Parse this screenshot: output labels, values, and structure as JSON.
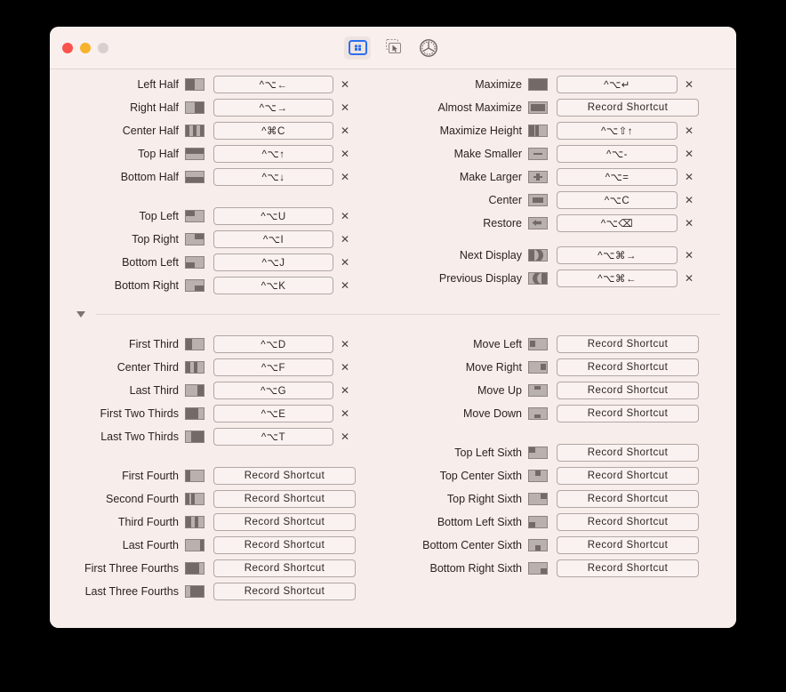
{
  "window": {
    "title": "",
    "traffic_lights": [
      "close",
      "minimize",
      "zoom"
    ],
    "accent": "#2a6ff0",
    "bg": "#f7eeec"
  },
  "toolbar": {
    "items": [
      {
        "name": "snap-areas-tab",
        "icon": "window-snap-icon",
        "active": true
      },
      {
        "name": "drag-snap-tab",
        "icon": "drag-to-snap-icon",
        "active": false
      },
      {
        "name": "settings-tab",
        "icon": "gear-icon",
        "active": false
      }
    ]
  },
  "record_placeholder": "Record Shortcut",
  "clear_glyph": "✕",
  "sections": {
    "left_top": [
      {
        "label": "Left Half",
        "thumb": "left-half",
        "shortcut": "^⌥←"
      },
      {
        "label": "Right Half",
        "thumb": "right-half",
        "shortcut": "^⌥→"
      },
      {
        "label": "Center Half",
        "thumb": "center-half",
        "shortcut": "^⌘C"
      },
      {
        "label": "Top Half",
        "thumb": "top-half",
        "shortcut": "^⌥↑"
      },
      {
        "label": "Bottom Half",
        "thumb": "bottom-half",
        "shortcut": "^⌥↓"
      }
    ],
    "left_quarters": [
      {
        "label": "Top Left",
        "thumb": "top-left",
        "shortcut": "^⌥U"
      },
      {
        "label": "Top Right",
        "thumb": "top-right",
        "shortcut": "^⌥I"
      },
      {
        "label": "Bottom Left",
        "thumb": "bottom-left",
        "shortcut": "^⌥J"
      },
      {
        "label": "Bottom Right",
        "thumb": "bottom-right",
        "shortcut": "^⌥K"
      }
    ],
    "left_thirds": [
      {
        "label": "First Third",
        "thumb": "first-third",
        "shortcut": "^⌥D"
      },
      {
        "label": "Center Third",
        "thumb": "center-third",
        "shortcut": "^⌥F"
      },
      {
        "label": "Last Third",
        "thumb": "last-third",
        "shortcut": "^⌥G"
      },
      {
        "label": "First Two Thirds",
        "thumb": "first-two-thirds",
        "shortcut": "^⌥E"
      },
      {
        "label": "Last Two Thirds",
        "thumb": "last-two-thirds",
        "shortcut": "^⌥T"
      }
    ],
    "left_fourths": [
      {
        "label": "First Fourth",
        "thumb": "first-fourth",
        "shortcut": ""
      },
      {
        "label": "Second Fourth",
        "thumb": "second-fourth",
        "shortcut": ""
      },
      {
        "label": "Third Fourth",
        "thumb": "third-fourth",
        "shortcut": ""
      },
      {
        "label": "Last Fourth",
        "thumb": "last-fourth",
        "shortcut": ""
      },
      {
        "label": "First Three Fourths",
        "thumb": "first-three-fourths",
        "shortcut": ""
      },
      {
        "label": "Last Three Fourths",
        "thumb": "last-three-fourths",
        "shortcut": ""
      }
    ],
    "right_top": [
      {
        "label": "Maximize",
        "thumb": "maximize",
        "shortcut": "^⌥↵"
      },
      {
        "label": "Almost Maximize",
        "thumb": "almost-maximize",
        "shortcut": ""
      },
      {
        "label": "Maximize Height",
        "thumb": "maximize-height",
        "shortcut": "^⌥⇧↑"
      },
      {
        "label": "Make Smaller",
        "thumb": "make-smaller",
        "shortcut": "^⌥-"
      },
      {
        "label": "Make Larger",
        "thumb": "make-larger",
        "shortcut": "^⌥="
      },
      {
        "label": "Center",
        "thumb": "center",
        "shortcut": "^⌥C"
      },
      {
        "label": "Restore",
        "thumb": "restore",
        "shortcut": "^⌥⌫"
      }
    ],
    "right_displays": [
      {
        "label": "Next Display",
        "thumb": "next-display",
        "shortcut": "^⌥⌘→"
      },
      {
        "label": "Previous Display",
        "thumb": "previous-display",
        "shortcut": "^⌥⌘←"
      }
    ],
    "right_moves": [
      {
        "label": "Move Left",
        "thumb": "move-left",
        "shortcut": ""
      },
      {
        "label": "Move Right",
        "thumb": "move-right",
        "shortcut": ""
      },
      {
        "label": "Move Up",
        "thumb": "move-up",
        "shortcut": ""
      },
      {
        "label": "Move Down",
        "thumb": "move-down",
        "shortcut": ""
      }
    ],
    "right_sixths": [
      {
        "label": "Top Left Sixth",
        "thumb": "top-left-sixth",
        "shortcut": ""
      },
      {
        "label": "Top Center Sixth",
        "thumb": "top-center-sixth",
        "shortcut": ""
      },
      {
        "label": "Top Right Sixth",
        "thumb": "top-right-sixth",
        "shortcut": ""
      },
      {
        "label": "Bottom Left Sixth",
        "thumb": "bottom-left-sixth",
        "shortcut": ""
      },
      {
        "label": "Bottom Center Sixth",
        "thumb": "bottom-center-sixth",
        "shortcut": ""
      },
      {
        "label": "Bottom Right Sixth",
        "thumb": "bottom-right-sixth",
        "shortcut": ""
      }
    ]
  }
}
